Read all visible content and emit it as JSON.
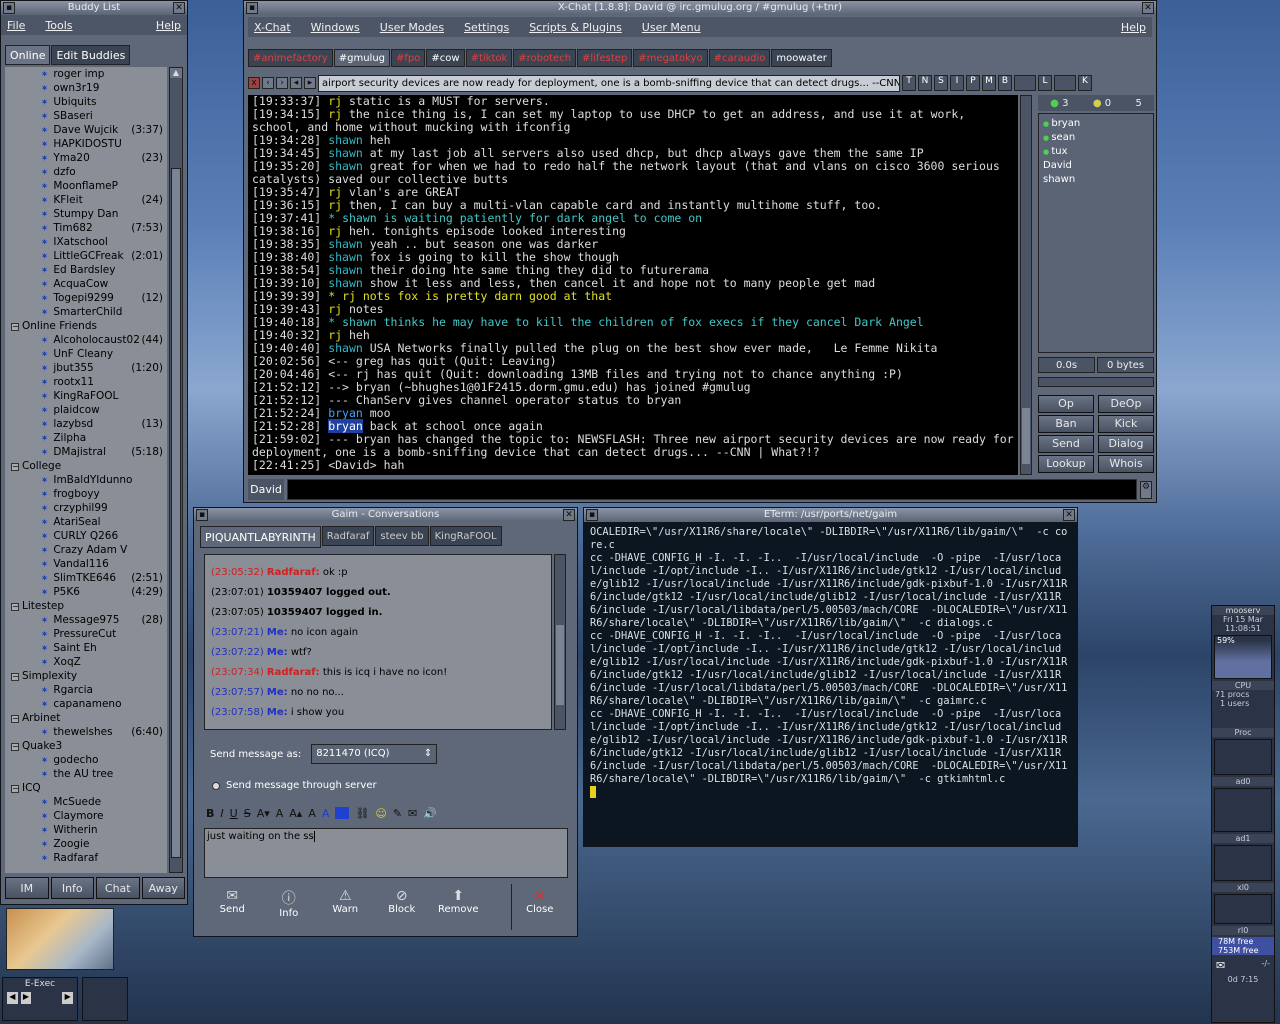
{
  "buddy": {
    "title": "Buddy List",
    "menus": [
      "File",
      "Tools",
      "Help"
    ],
    "tabs": [
      "Online",
      "Edit Buddies"
    ],
    "rows": [
      {
        "t": "b",
        "name": "roger imp"
      },
      {
        "t": "b",
        "name": "own3r19"
      },
      {
        "t": "b",
        "name": "Ubiquits"
      },
      {
        "t": "b",
        "name": "SBaseri"
      },
      {
        "t": "b",
        "name": "Dave Wujcik",
        "idle": "(3:37)"
      },
      {
        "t": "b",
        "name": "HAPKIDOSTU"
      },
      {
        "t": "b",
        "name": "Yma20",
        "idle": "(23)"
      },
      {
        "t": "b",
        "name": "dzfo"
      },
      {
        "t": "b",
        "name": "MoonflameP"
      },
      {
        "t": "b",
        "name": "KFleit",
        "idle": "(24)"
      },
      {
        "t": "b",
        "name": "Stumpy Dan"
      },
      {
        "t": "b",
        "name": "Tim682",
        "idle": "(7:53)"
      },
      {
        "t": "b",
        "name": "IXatschool"
      },
      {
        "t": "b",
        "name": "LittleGCFreak",
        "idle": "(2:01)"
      },
      {
        "t": "b",
        "name": "Ed Bardsley"
      },
      {
        "t": "b",
        "name": "AcquaCow"
      },
      {
        "t": "b",
        "name": "Togepi9299",
        "idle": "(12)"
      },
      {
        "t": "b",
        "name": "SmarterChild"
      },
      {
        "t": "g",
        "name": "Online Friends"
      },
      {
        "t": "b",
        "name": "Alcoholocaust02",
        "idle": "(44)"
      },
      {
        "t": "b",
        "name": "UnF Cleany"
      },
      {
        "t": "b",
        "name": "jbut355",
        "idle": "(1:20)"
      },
      {
        "t": "b",
        "name": "rootx11"
      },
      {
        "t": "b",
        "name": "KingRaFOOL"
      },
      {
        "t": "b",
        "name": "plaidcow"
      },
      {
        "t": "b",
        "name": "lazybsd",
        "idle": "(13)"
      },
      {
        "t": "b",
        "name": "Zilpha"
      },
      {
        "t": "b",
        "name": "DMajistral",
        "idle": "(5:18)"
      },
      {
        "t": "g",
        "name": "College"
      },
      {
        "t": "b",
        "name": "ImBaldYIdunno"
      },
      {
        "t": "b",
        "name": "frogboyy"
      },
      {
        "t": "b",
        "name": "crzyphil99"
      },
      {
        "t": "b",
        "name": "AtariSeal"
      },
      {
        "t": "b",
        "name": "CURLY Q266"
      },
      {
        "t": "b",
        "name": "Crazy Adam V"
      },
      {
        "t": "b",
        "name": "Vandal116"
      },
      {
        "t": "b",
        "name": "SlimTKE646",
        "idle": "(2:51)"
      },
      {
        "t": "b",
        "name": "P5K6",
        "idle": "(4:29)"
      },
      {
        "t": "g",
        "name": "Litestep"
      },
      {
        "t": "b",
        "name": "Message975",
        "idle": "(28)"
      },
      {
        "t": "b",
        "name": "PressureCut"
      },
      {
        "t": "b",
        "name": "Saint Eh"
      },
      {
        "t": "b",
        "name": "XoqZ"
      },
      {
        "t": "g",
        "name": "Simplexity"
      },
      {
        "t": "b",
        "name": "Rgarcia"
      },
      {
        "t": "b",
        "name": "capanameno"
      },
      {
        "t": "g",
        "name": "Arbinet"
      },
      {
        "t": "b",
        "name": "thewelshes",
        "idle": "(6:40)"
      },
      {
        "t": "g",
        "name": "Quake3"
      },
      {
        "t": "b",
        "name": "godecho"
      },
      {
        "t": "b",
        "name": "the AU tree"
      },
      {
        "t": "g",
        "name": "ICQ"
      },
      {
        "t": "b",
        "name": "McSuede"
      },
      {
        "t": "b",
        "name": "Claymore"
      },
      {
        "t": "b",
        "name": "Witherin"
      },
      {
        "t": "b",
        "name": "Zoogie"
      },
      {
        "t": "b",
        "name": "Radfaraf"
      }
    ],
    "buttons": [
      "IM",
      "Info",
      "Chat",
      "Away"
    ]
  },
  "xchat": {
    "title": "X-Chat [1.8.8]: David @ irc.gmulug.org / #gmulug (+tnr)",
    "menus": [
      "X-Chat",
      "Windows",
      "User Modes",
      "Settings",
      "Scripts & Plugins",
      "User Menu",
      "Help"
    ],
    "tabs": [
      "#animefactory",
      "#gmulug",
      "#fpo",
      "#cow",
      "#tiktok",
      "#robotech",
      "#lifestep",
      "#megatokyo",
      "#caraudio",
      "moowater"
    ],
    "topic": "airport security devices are now ready for deployment, one is a bomb-sniffing device that can detect drugs... --CNN | What?!?",
    "modes": [
      "T",
      "N",
      "S",
      "I",
      "P",
      "M",
      "B",
      "L",
      "K"
    ],
    "lines": [
      {
        "ts": "[19:33:37]",
        "nick": "rj",
        "c": "n-rj",
        "msg": "static is a MUST for servers."
      },
      {
        "ts": "[19:34:15]",
        "nick": "rj",
        "c": "n-rj",
        "msg": "the nice thing is, I can set my laptop to use DHCP to get an address, and use it at work, school, and home without mucking with ifconfig"
      },
      {
        "ts": "[19:34:28]",
        "nick": "shawn",
        "c": "n-sh",
        "msg": "heh"
      },
      {
        "ts": "[19:34:45]",
        "nick": "shawn",
        "c": "n-sh",
        "msg": "at my last job all servers also used dhcp, but dhcp always gave them the same IP"
      },
      {
        "ts": "[19:35:20]",
        "nick": "shawn",
        "c": "n-sh",
        "msg": "great for when we had to redo half the network layout (that and vlans on cisco 3600 serious catalysts) saved our collective butts"
      },
      {
        "ts": "[19:35:47]",
        "nick": "rj",
        "c": "n-rj",
        "msg": "vlan's are GREAT"
      },
      {
        "ts": "[19:36:15]",
        "nick": "rj",
        "c": "n-rj",
        "msg": "then, I can buy a multi-vlan capable card and instantly multihome stuff, too."
      },
      {
        "ts": "[19:37:41]",
        "nick": "*",
        "c": "act",
        "msg": "shawn is waiting patiently for dark angel to come on",
        "action": true
      },
      {
        "ts": "[19:38:16]",
        "nick": "rj",
        "c": "n-rj",
        "msg": "heh. tonights episode looked interesting"
      },
      {
        "ts": "[19:38:35]",
        "nick": "shawn",
        "c": "n-sh",
        "msg": "yeah .. but season one was darker"
      },
      {
        "ts": "[19:38:40]",
        "nick": "shawn",
        "c": "n-sh",
        "msg": "fox is going to kill the show though"
      },
      {
        "ts": "[19:38:54]",
        "nick": "shawn",
        "c": "n-sh",
        "msg": "their doing hte same thing they did to futurerama"
      },
      {
        "ts": "[19:39:10]",
        "nick": "shawn",
        "c": "n-sh",
        "msg": "show it less and less, then cancel it and hope not to many people get mad"
      },
      {
        "ts": "[19:39:39]",
        "nick": "*",
        "c": "n-rj",
        "msg": "rj nots fox is pretty darn good at that",
        "action": true
      },
      {
        "ts": "[19:39:43]",
        "nick": "rj",
        "c": "n-rj",
        "msg": "notes"
      },
      {
        "ts": "[19:40:18]",
        "nick": "*",
        "c": "act",
        "msg": "shawn thinks he may have to kill the children of fox execs if they cancel Dark Angel",
        "action": true
      },
      {
        "ts": "[19:40:32]",
        "nick": "rj",
        "c": "n-rj",
        "msg": "heh"
      },
      {
        "ts": "[19:40:40]",
        "nick": "shawn",
        "c": "n-sh",
        "msg": "USA Networks finally pulled the plug on the best show ever made,   Le Femme Nikita"
      },
      {
        "ts": "[20:02:56]",
        "nick": "<--",
        "c": "sys",
        "msg": "greg has quit (Quit: Leaving)"
      },
      {
        "ts": "[20:04:46]",
        "nick": "<--",
        "c": "sys",
        "msg": "rj has quit (Quit: downloading 13MB files and trying not to chance anything :P)"
      },
      {
        "ts": "[21:52:12]",
        "nick": "-->",
        "c": "sys",
        "msg": "bryan (~bhughes1@01F2415.dorm.gmu.edu) has joined #gmulug"
      },
      {
        "ts": "[21:52:12]",
        "nick": "---",
        "c": "sys",
        "msg": "ChanServ gives channel operator status to bryan"
      },
      {
        "ts": "[21:52:24]",
        "nick": "bryan",
        "c": "n-br",
        "msg": "moo"
      },
      {
        "ts": "[21:52:28]",
        "nick": "bryan",
        "c": "n-br",
        "msg": "back at school once again"
      },
      {
        "ts": "[21:59:02]",
        "nick": "---",
        "c": "sys",
        "msg": "bryan has changed the topic to: NEWSFLASH: Three new airport security devices are now ready for deployment, one is a bomb-sniffing device that can detect drugs... --CNN | What?!?"
      },
      {
        "ts": "[22:41:25]",
        "nick": "<David>",
        "c": "sys",
        "msg": "hah"
      }
    ],
    "counts": [
      "3",
      "0",
      "5"
    ],
    "users": [
      "bryan",
      "sean",
      "tux",
      "David",
      "shawn"
    ],
    "lag": "0.0s",
    "bytes": "0 bytes",
    "ops": [
      "Op",
      "DeOp",
      "Ban",
      "Kick",
      "Send",
      "Dialog",
      "Lookup",
      "Whois"
    ],
    "nick": "David"
  },
  "gaim": {
    "title": "Gaim - Conversations",
    "tabs": [
      "PIQUANTLABYRINTH",
      "Radfaraf",
      "steev bb",
      "KingRaFOOL"
    ],
    "msgs": [
      {
        "ts": "(23:05:32)",
        "who": "Radfaraf:",
        "c": "ts-r",
        "msg": "ok :p"
      },
      {
        "ts": "(23:07:01)",
        "who": "10359407 logged out.",
        "c": "",
        "msg": ""
      },
      {
        "ts": "(23:07:05)",
        "who": "10359407 logged in.",
        "c": "",
        "msg": ""
      },
      {
        "ts": "(23:07:21)",
        "who": "Me:",
        "c": "ts-b",
        "msg": "no icon again"
      },
      {
        "ts": "(23:07:22)",
        "who": "Me:",
        "c": "ts-b",
        "msg": "wtf?"
      },
      {
        "ts": "(23:07:34)",
        "who": "Radfaraf:",
        "c": "ts-r",
        "msg": "this is icq i have no icon!"
      },
      {
        "ts": "(23:07:57)",
        "who": "Me:",
        "c": "ts-b",
        "msg": "no no no..."
      },
      {
        "ts": "(23:07:58)",
        "who": "Me:",
        "c": "ts-b",
        "msg": "i show you"
      }
    ],
    "send_as_label": "Send message as:",
    "send_as_value": "8211470 (ICQ)",
    "through_server": "Send message through server",
    "input": "just waiting on the ss",
    "actions": [
      "Send",
      "Info",
      "Warn",
      "Block",
      "Remove",
      "Close"
    ]
  },
  "eterm": {
    "title": "ETerm: /usr/ports/net/gaim",
    "text": "OCALEDIR=\\\"/usr/X11R6/share/locale\\\" -DLIBDIR=\\\"/usr/X11R6/lib/gaim/\\\"  -c core.c\ncc -DHAVE_CONFIG_H -I. -I. -I..  -I/usr/local/include  -O -pipe  -I/usr/local/include -I/opt/include -I.. -I/usr/X11R6/include/gtk12 -I/usr/local/include/glib12 -I/usr/local/include -I/usr/X11R6/include/gdk-pixbuf-1.0 -I/usr/X11R6/include/gtk12 -I/usr/local/include/glib12 -I/usr/local/include -I/usr/X11R6/include -I/usr/local/libdata/perl/5.00503/mach/CORE  -DLOCALEDIR=\\\"/usr/X11R6/share/locale\\\" -DLIBDIR=\\\"/usr/X11R6/lib/gaim/\\\"  -c dialogs.c\ncc -DHAVE_CONFIG_H -I. -I. -I..  -I/usr/local/include  -O -pipe  -I/usr/local/include -I/opt/include -I.. -I/usr/X11R6/include/gtk12 -I/usr/local/include/glib12 -I/usr/local/include -I/usr/X11R6/include/gdk-pixbuf-1.0 -I/usr/X11R6/include/gtk12 -I/usr/local/include/glib12 -I/usr/local/include -I/usr/X11R6/include -I/usr/local/libdata/perl/5.00503/mach/CORE  -DLOCALEDIR=\\\"/usr/X11R6/share/locale\\\" -DLIBDIR=\\\"/usr/X11R6/lib/gaim/\\\"  -c gaimrc.c\ncc -DHAVE_CONFIG_H -I. -I. -I..  -I/usr/local/include  -O -pipe  -I/usr/local/include -I/opt/include -I.. -I/usr/X11R6/include/gtk12 -I/usr/local/include/glib12 -I/usr/local/include -I/usr/X11R6/include/gdk-pixbuf-1.0 -I/usr/X11R6/include/gtk12 -I/usr/local/include/glib12 -I/usr/local/include -I/usr/X11R6/include -I/usr/local/libdata/perl/5.00503/mach/CORE  -DLOCALEDIR=\\\"/usr/X11R6/share/locale\\\" -DLIBDIR=\\\"/usr/X11R6/lib/gaim/\\\"  -c gtkimhtml.c"
  },
  "eexec": "E-Exec",
  "dock": {
    "host": "mooserv",
    "date": "Fri 15 Mar",
    "time": "11:08:51",
    "cpu_pct": "59%",
    "cpu": "CPU",
    "procs": "71 procs",
    "users": "1 users",
    "proc": "Proc",
    "ad0": "ad0",
    "ad1": "ad1",
    "xl0": "xl0",
    "rl0": "rl0",
    "mem1": "78M free",
    "mem2": "753M free",
    "mail": "-/-",
    "uptime": "0d 7:15"
  },
  "colors": {
    "accent": "#30b8c8",
    "rj": "#e0e020",
    "bryan": "#40a0ff"
  }
}
